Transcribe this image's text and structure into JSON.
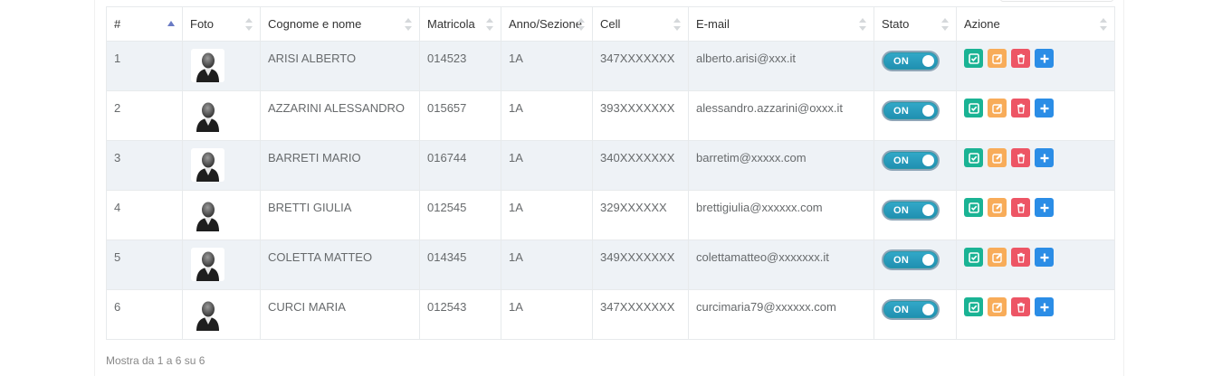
{
  "columns": [
    {
      "label": "#"
    },
    {
      "label": "Foto"
    },
    {
      "label": "Cognome e nome"
    },
    {
      "label": "Matricola"
    },
    {
      "label": "Anno/Sezione"
    },
    {
      "label": "Cell"
    },
    {
      "label": "E-mail"
    },
    {
      "label": "Stato"
    },
    {
      "label": "Azione"
    }
  ],
  "sorted_column": "#",
  "rows": [
    {
      "num": "1",
      "name": "ARISI ALBERTO",
      "matricola": "014523",
      "anno": "1A",
      "cell": "347XXXXXXX",
      "email": "alberto.arisi@xxx.it",
      "stato": "ON"
    },
    {
      "num": "2",
      "name": "AZZARINI ALESSANDRO",
      "matricola": "015657",
      "anno": "1A",
      "cell": "393XXXXXXX",
      "email": "alessandro.azzarini@oxxx.it",
      "stato": "ON"
    },
    {
      "num": "3",
      "name": "BARRETI MARIO",
      "matricola": "016744",
      "anno": "1A",
      "cell": "340XXXXXXX",
      "email": "barretim@xxxxx.com",
      "stato": "ON"
    },
    {
      "num": "4",
      "name": "BRETTI GIULIA",
      "matricola": "012545",
      "anno": "1A",
      "cell": "329XXXXXX",
      "email": "brettigiulia@xxxxxx.com",
      "stato": "ON"
    },
    {
      "num": "5",
      "name": "COLETTA MATTEO",
      "matricola": "014345",
      "anno": "1A",
      "cell": "349XXXXXXX",
      "email": "colettamatteo@xxxxxxx.it",
      "stato": "ON"
    },
    {
      "num": "6",
      "name": "CURCI MARIA",
      "matricola": "012543",
      "anno": "1A",
      "cell": "347XXXXXXX",
      "email": "curcimaria79@xxxxxx.com",
      "stato": "ON"
    }
  ],
  "action_buttons": [
    {
      "name": "view-button",
      "icon": "check-square-icon",
      "color": "#1ab394"
    },
    {
      "name": "edit-button",
      "icon": "pencil-square-icon",
      "color": "#f8ac59"
    },
    {
      "name": "delete-button",
      "icon": "trash-icon",
      "color": "#ed5565"
    },
    {
      "name": "add-button",
      "icon": "plus-icon",
      "color": "#2b8de6"
    }
  ],
  "footer": {
    "text": "Mostra da 1 a 6 su 6"
  }
}
